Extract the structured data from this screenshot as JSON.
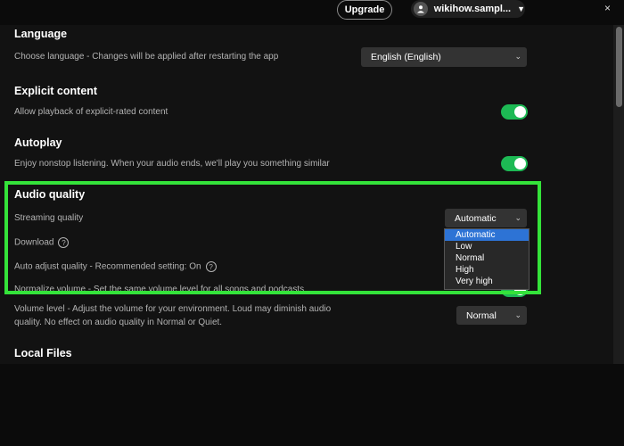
{
  "topbar": {
    "upgrade_label": "Upgrade",
    "username": "wikihow.sampl...",
    "close_glyph": "×"
  },
  "language": {
    "title": "Language",
    "description": "Choose language - Changes will be applied after restarting the app",
    "selected": "English (English)"
  },
  "explicit": {
    "title": "Explicit content",
    "description": "Allow playback of explicit-rated content",
    "enabled": true
  },
  "autoplay": {
    "title": "Autoplay",
    "description": "Enjoy nonstop listening. When your audio ends, we'll play you something similar",
    "enabled": true
  },
  "audio_quality": {
    "title": "Audio quality",
    "streaming_label": "Streaming quality",
    "streaming_selected": "Automatic",
    "streaming_options": [
      "Automatic",
      "Low",
      "Normal",
      "High",
      "Very high"
    ],
    "download_label": "Download",
    "auto_adjust_label": "Auto adjust quality - Recommended setting: On",
    "normalize_label": "Normalize volume - Set the same volume level for all songs and podcasts",
    "volume_level_line1": "Volume level - Adjust the volume for your environment. Loud may diminish audio",
    "volume_level_line2": "quality. No effect on audio quality in Normal or Quiet.",
    "volume_level_selected": "Normal"
  },
  "local_files": {
    "title": "Local Files"
  },
  "colors": {
    "background": "#121212",
    "toggle_on": "#1db954",
    "highlight": "#34e33a",
    "dropdown_selected": "#2d73d5"
  }
}
